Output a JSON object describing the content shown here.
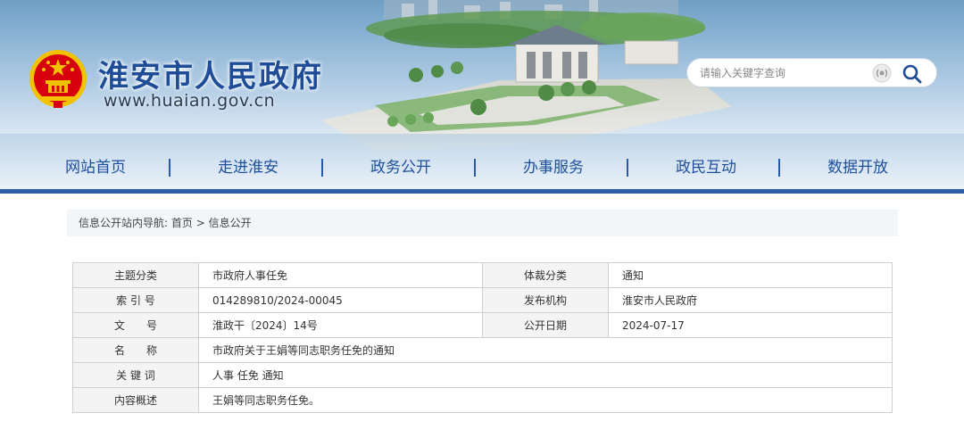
{
  "header": {
    "site_title": "淮安市人民政府",
    "site_url": "www.huaian.gov.cn",
    "emblem_icon": "national-emblem-icon",
    "search": {
      "placeholder": "请输入关键字查询",
      "voice_icon": "voice-icon",
      "search_icon": "search-icon"
    }
  },
  "nav": {
    "items": [
      {
        "label": "网站首页"
      },
      {
        "label": "走进淮安"
      },
      {
        "label": "政务公开"
      },
      {
        "label": "办事服务"
      },
      {
        "label": "政民互动"
      },
      {
        "label": "数据开放"
      }
    ],
    "separator": "|"
  },
  "breadcrumb": {
    "prefix": "信息公开站内导航:",
    "home": "首页",
    "arrow": ">",
    "current": "信息公开"
  },
  "meta": {
    "theme_label": "主题分类",
    "theme_value": "市政府人事任免",
    "genre_label": "体裁分类",
    "genre_value": "通知",
    "index_label": "索 引 号",
    "index_value": "014289810/2024-00045",
    "publisher_label": "发布机构",
    "publisher_value": "淮安市人民政府",
    "docno_label": "文　　号",
    "docno_value": "淮政干〔2024〕14号",
    "date_label": "公开日期",
    "date_value": "2024-07-17",
    "name_label": "名　　称",
    "name_value": "市政府关于王娟等同志职务任免的通知",
    "keywords_label": "关 键 词",
    "keywords_value": "人事 任免 通知",
    "summary_label": "内容概述",
    "summary_value": "王娟等同志职务任免。"
  },
  "colors": {
    "brand_blue": "#1f4c96",
    "nav_bar": "#2f5ea8",
    "emblem_red": "#d7000f",
    "emblem_gold": "#f2c200"
  }
}
